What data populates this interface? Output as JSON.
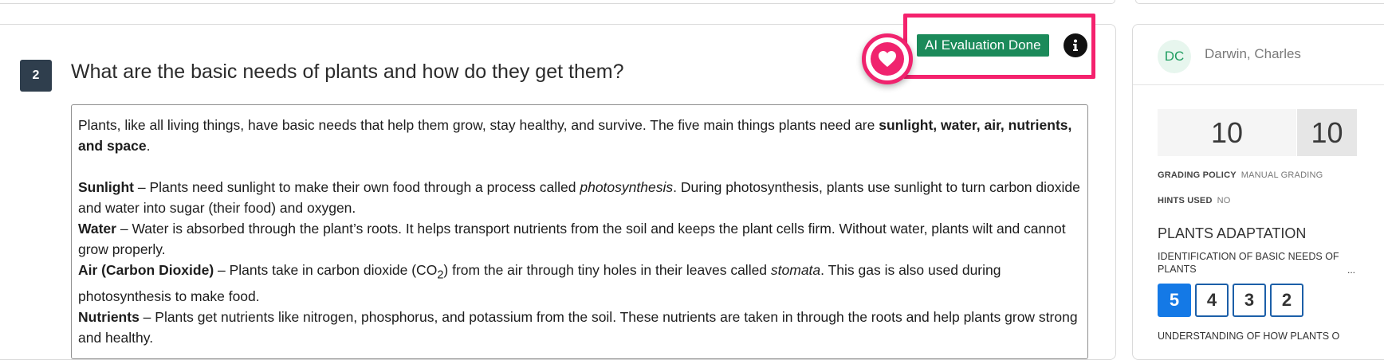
{
  "question": {
    "number": "2",
    "title": "What are the basic needs of plants and how do they get them?"
  },
  "evaluation": {
    "badge_label": "AI Evaluation Done",
    "favorite_icon": "heart-icon",
    "info_icon": "info-icon"
  },
  "answer": {
    "intro_text": "Plants, like all living things, have basic needs that help them grow, stay healthy, and survive. The five main things plants need are ",
    "intro_bold": "sunlight, water, air, nutrients, and space",
    "intro_end": ".",
    "sunlight_term": "Sunlight",
    "sunlight_text_1": " – Plants need sunlight to make their own food through a process called ",
    "sunlight_italic": "photosynthesis",
    "sunlight_text_2": ". During photosynthesis, plants use sunlight to turn carbon dioxide and water into sugar (their food) and oxygen.",
    "water_term": "Water",
    "water_text": " – Water is absorbed through the plant’s roots. It helps transport nutrients from the soil and keeps the plant cells firm. Without water, plants wilt and cannot grow properly.",
    "air_term": "Air (Carbon Dioxide)",
    "air_text_1": " – Plants take in carbon dioxide (CO",
    "air_sub": "2",
    "air_text_2": ") from the air through tiny holes in their leaves called ",
    "air_italic": "stomata",
    "air_text_3": ". This gas is also used during photosynthesis to make food.",
    "nutrients_term": "Nutrients",
    "nutrients_text": " – Plants get nutrients like nitrogen, phosphorus, and potassium from the soil. These nutrients are taken in through the roots and help plants grow strong and healthy."
  },
  "student": {
    "initials": "DC",
    "name": "Darwin, Charles"
  },
  "score": {
    "earned": "10",
    "total": "10"
  },
  "meta": {
    "grading_policy_label": "GRADING POLICY",
    "grading_policy_value": "MANUAL GRADING",
    "hints_label": "HINTS USED",
    "hints_value": "NO"
  },
  "rubric": {
    "section_title": "PLANTS ADAPTATION",
    "criterion_1": "IDENTIFICATION OF BASIC NEEDS OF PLANTS",
    "criterion_1_more": "...",
    "ratings": [
      "5",
      "4",
      "3",
      "2"
    ],
    "selected_rating": "5",
    "criterion_2": "UNDERSTANDING OF HOW PLANTS O"
  },
  "colors": {
    "badge": "#1b8a5a",
    "highlight": "#f4226d",
    "question_number_bg": "#2f3e4d",
    "rating_active": "#1479e6"
  }
}
